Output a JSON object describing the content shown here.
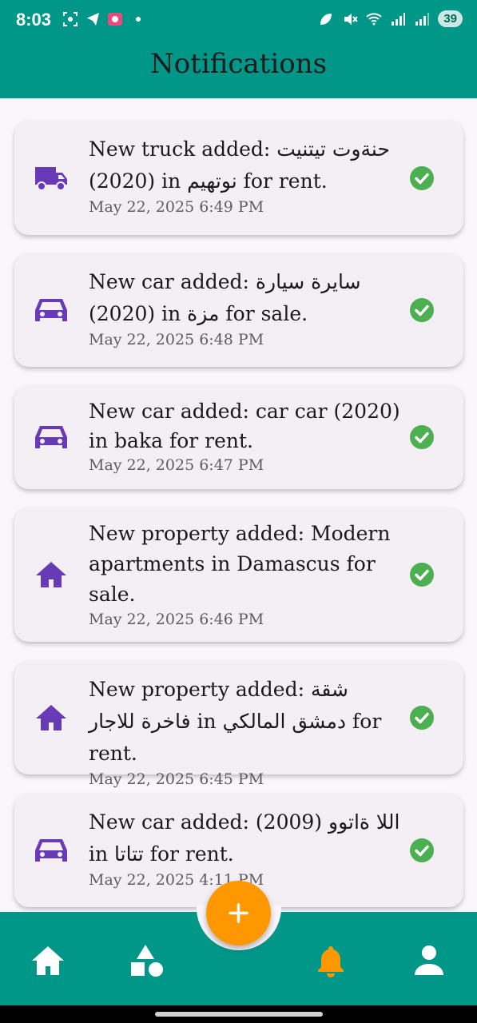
{
  "status_bar": {
    "time": "8:03",
    "battery": "39"
  },
  "app_bar": {
    "title": "Notifications"
  },
  "notifications": [
    {
      "icon": "truck-icon",
      "message": "New truck added: حنةوت تيتنيت (2020) in نوتهيم for rent.",
      "timestamp": "May 22, 2025 6:49 PM",
      "status": "check-circle-icon"
    },
    {
      "icon": "car-icon",
      "message": "New car added: سايرة سيارة (2020) in مزة for sale.",
      "timestamp": "May 22, 2025 6:48 PM",
      "status": "check-circle-icon"
    },
    {
      "icon": "car-icon",
      "message": "New car added: car car (2020) in baka for rent.",
      "timestamp": "May 22, 2025 6:47 PM",
      "status": "check-circle-icon"
    },
    {
      "icon": "home-icon",
      "message": "New property added: Modern apartments in Damascus for sale.",
      "timestamp": "May 22, 2025 6:46 PM",
      "status": "check-circle-icon"
    },
    {
      "icon": "home-icon",
      "message": "New property added: شقة فاخرة للاجار in دمشق المالكي for rent.",
      "timestamp": "May 22, 2025 6:45 PM",
      "status": "check-circle-icon"
    },
    {
      "icon": "car-icon",
      "message": "New car added: اللا ةاتوو (2009) in تتاتا for rent.",
      "timestamp": "May 22, 2025 4:11 PM",
      "status": "check-circle-icon"
    }
  ],
  "fab": {
    "icon": "plus-icon"
  },
  "bottom_nav": [
    {
      "icon": "home-icon",
      "active": false
    },
    {
      "icon": "shapes-icon",
      "active": false
    },
    {
      "icon": "bell-icon",
      "active": true
    },
    {
      "icon": "person-icon",
      "active": false
    }
  ],
  "colors": {
    "primary": "#009688",
    "accent": "#ff9800",
    "icon": "#673ab7",
    "success": "#4caf50",
    "card": "#f4eff5"
  }
}
